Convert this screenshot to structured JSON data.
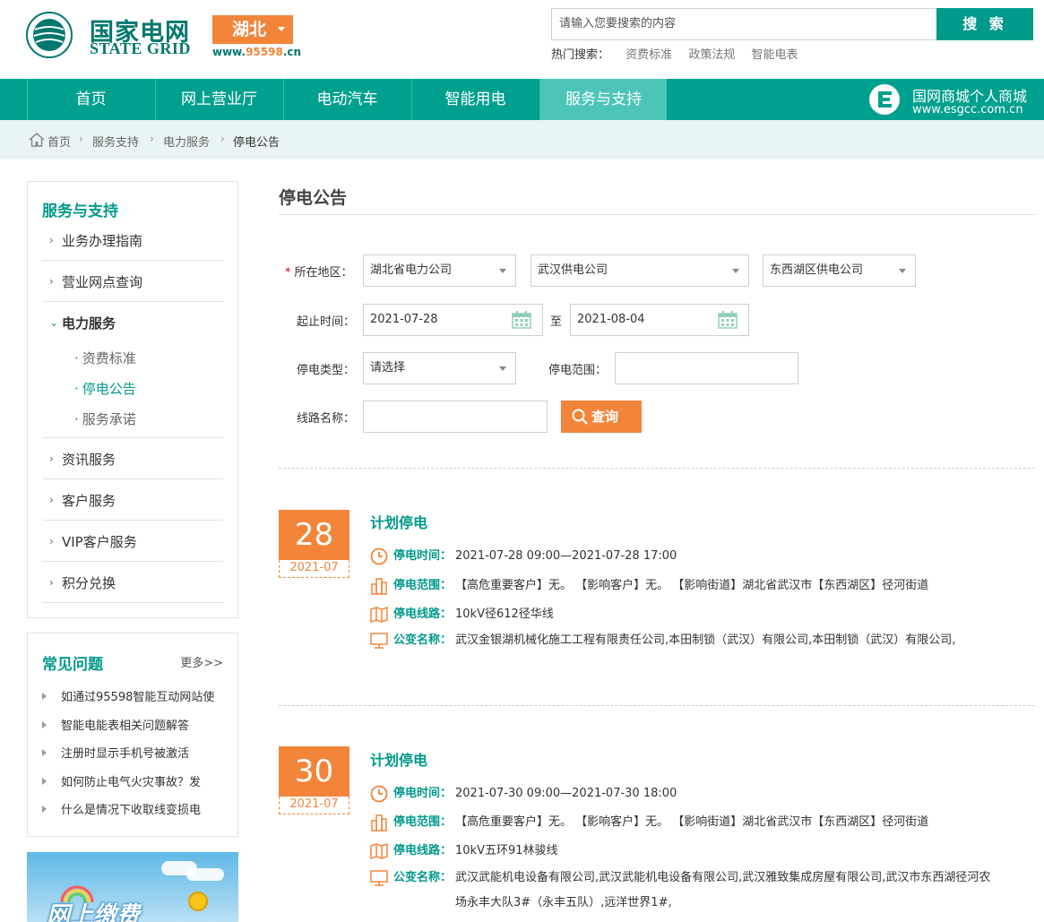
{
  "header": {
    "logo_cn": "国家电网",
    "logo_en": "STATE GRID",
    "region": "湖北",
    "site_url_prefix": "www.",
    "site_url_hl": "95598",
    "site_url_suffix": ".cn",
    "search_placeholder": "请输入您要搜索的内容",
    "search_button": "搜 索",
    "hot_label": "热门搜索：",
    "hot_items": [
      "资费标准",
      "政策法规",
      "智能电表"
    ]
  },
  "nav": {
    "items": [
      "首页",
      "网上营业厅",
      "电动汽车",
      "智能用电",
      "服务与支持"
    ],
    "active_index": 4,
    "mall_title": "国网商城个人商城",
    "mall_url": "www.esgcc.com.cn"
  },
  "breadcrumb": [
    "首页",
    "服务支持",
    "电力服务",
    "停电公告"
  ],
  "sidebar": {
    "title": "服务与支持",
    "items": [
      "业务办理指南",
      "营业网点查询",
      "电力服务",
      "资讯服务",
      "客户服务",
      "VIP客户服务",
      "积分兑换"
    ],
    "sub_items": [
      "资费标准",
      "停电公告",
      "服务承诺"
    ],
    "sub_active_index": 1
  },
  "faq": {
    "title": "常见问题",
    "more": "更多>>",
    "items": [
      "如通过95598智能互动网站使",
      "智能电能表相关问题解答",
      "注册时显示手机号被激活",
      "如何防止电气火灾事故？发",
      "什么是情况下收取线变损电"
    ]
  },
  "banner": {
    "text": "网上缴费"
  },
  "main": {
    "title": "停电公告",
    "form": {
      "region_label": "所在地区：",
      "region_required": "*",
      "region_values": [
        "湖北省电力公司",
        "武汉供电公司",
        "东西湖区供电公司"
      ],
      "time_label": "起止时间：",
      "start_date": "2021-07-28",
      "to_label": "至",
      "end_date": "2021-08-04",
      "type_label": "停电类型：",
      "type_value": "请选择",
      "scope_label": "停电范围：",
      "scope_value": "",
      "line_label": "线路名称：",
      "line_value": "",
      "query_button": "查询"
    },
    "notices": [
      {
        "day": "28",
        "ym": "2021-07",
        "title": "计划停电",
        "time_k": "停电时间：",
        "time_v": "2021-07-28 09:00—2021-07-28 17:00",
        "scope_k": "停电范围：",
        "scope_v": "【高危重要客户】无。 【影响客户】无。 【影响街道】湖北省武汉市【东西湖区】径河街道",
        "line_k": "停电线路：",
        "line_v": "10kV径612径华线",
        "user_k": "公变名称：",
        "user_v": "武汉金银湖机械化施工工程有限责任公司,本田制锁（武汉）有限公司,本田制锁（武汉）有限公司,"
      },
      {
        "day": "30",
        "ym": "2021-07",
        "title": "计划停电",
        "time_k": "停电时间：",
        "time_v": "2021-07-30 09:00—2021-07-30 18:00",
        "scope_k": "停电范围：",
        "scope_v": "【高危重要客户】无。 【影响客户】无。 【影响街道】湖北省武汉市【东西湖区】径河街道",
        "line_k": "停电线路：",
        "line_v": "10kV五环91林骏线",
        "user_k": "公变名称：",
        "user_v": "武汉武能机电设备有限公司,武汉武能机电设备有限公司,武汉雅致集成房屋有限公司,武汉市东西湖径河农场永丰大队3#（永丰五队）,远洋世界1#,"
      }
    ]
  }
}
